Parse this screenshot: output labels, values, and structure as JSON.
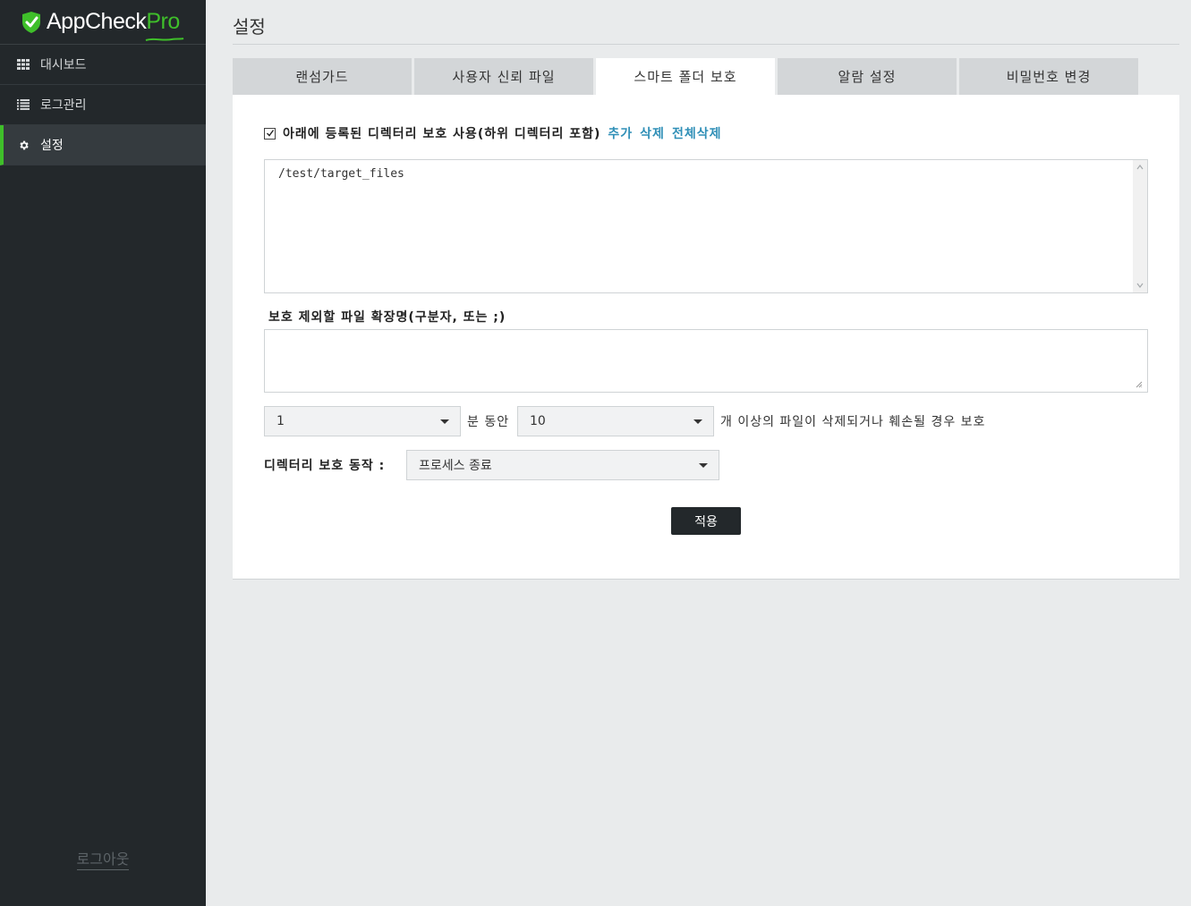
{
  "app": {
    "logo_text": "AppCheck",
    "logo_pro": "Pro",
    "brand_color": "#3fbf2a"
  },
  "sidebar": {
    "items": [
      {
        "label": "대시보드",
        "icon": "grid-icon",
        "active": false
      },
      {
        "label": "로그관리",
        "icon": "list-icon",
        "active": false
      },
      {
        "label": "설정",
        "icon": "gear-icon",
        "active": true
      }
    ],
    "logout_label": "로그아웃"
  },
  "page": {
    "title": "설정"
  },
  "tabs": [
    {
      "label": "랜섬가드",
      "active": false
    },
    {
      "label": "사용자 신뢰 파일",
      "active": false
    },
    {
      "label": "스마트 폴더 보호",
      "active": true
    },
    {
      "label": "알람 설정",
      "active": false
    },
    {
      "label": "비밀번호 변경",
      "active": false
    }
  ],
  "folder_protection": {
    "enable_label": "아래에 등록된 디렉터리 보호 사용(하위 디렉터리 포함)",
    "enabled": true,
    "add_label": "추가",
    "delete_label": "삭제",
    "delete_all_label": "전체삭제",
    "directories": [
      "/test/target_files"
    ],
    "exclude_ext_label": "보호 제외할 파일 확장명(구분자, 또는 ;)",
    "exclude_ext_value": "",
    "minutes_value": "1",
    "minutes_suffix": "분 동안",
    "file_count_value": "10",
    "file_count_suffix": "개 이상의 파일이 삭제되거나 훼손될 경우 보호",
    "action_label": "디렉터리 보호 동작 :",
    "action_value": "프로세스 종료",
    "apply_label": "적용"
  }
}
